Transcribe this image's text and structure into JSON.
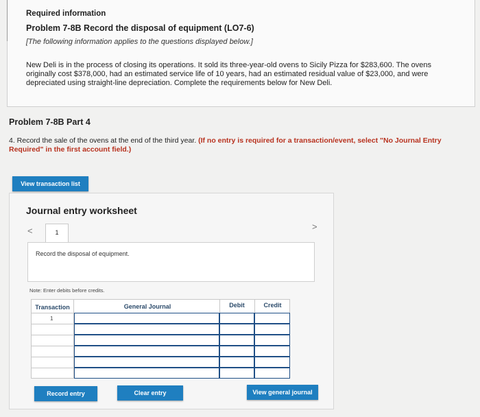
{
  "header": {
    "required_info": "Required information",
    "problem_title": "Problem 7-8B Record the disposal of equipment (LO7-6)",
    "note": "[The following information applies to the questions displayed below.]",
    "description": "New Deli is in the process of closing its operations. It sold its three-year-old ovens to Sicily Pizza for $283,600. The ovens originally cost $378,000, had an estimated service life of 10 years, had an estimated residual value of $23,000, and were depreciated using straight-line depreciation. Complete the requirements below for New Deli."
  },
  "part": {
    "title": "Problem 7-8B Part 4",
    "question_text": "4. Record the sale of the ovens at the end of the third year.",
    "question_instruction": "(If no entry is required for a transaction/event, select \"No Journal Entry Required\" in the first account field.)"
  },
  "buttons": {
    "view_transaction_list": "View transaction list",
    "record_entry": "Record entry",
    "clear_entry": "Clear entry",
    "view_general_journal": "View general journal"
  },
  "worksheet": {
    "title": "Journal entry worksheet",
    "nav_prev": "<",
    "nav_next": ">",
    "active_tab": "1",
    "record_prompt": "Record the disposal of equipment.",
    "note": "Note: Enter debits before credits.",
    "columns": {
      "transaction": "Transaction",
      "general_journal": "General Journal",
      "debit": "Debit",
      "credit": "Credit"
    },
    "transaction_number": "1"
  }
}
